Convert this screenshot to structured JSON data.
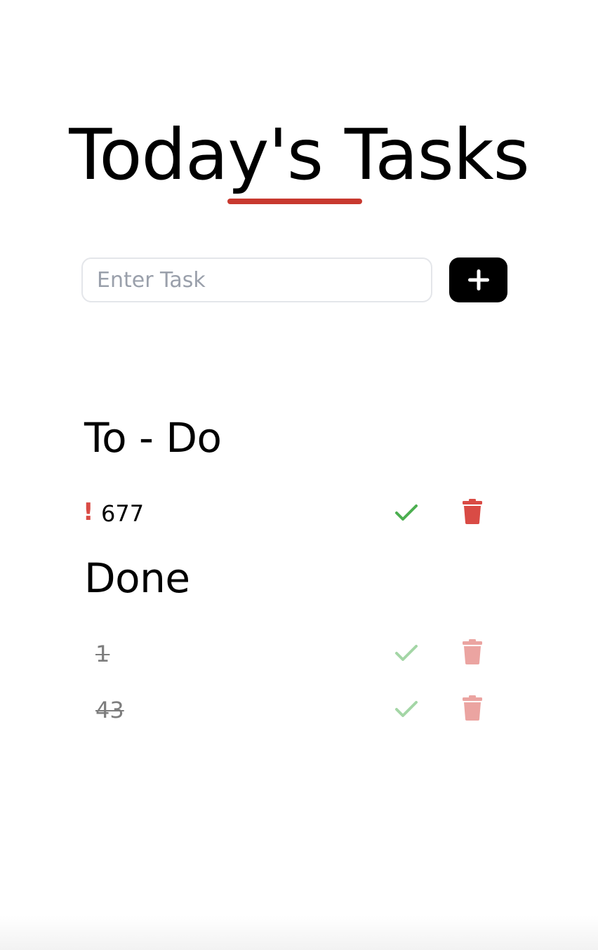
{
  "header": {
    "title": "Today's Tasks",
    "accent_color": "#c8392f"
  },
  "new_task": {
    "placeholder": "Enter Task",
    "value": "",
    "add_icon": "plus-icon"
  },
  "sections": {
    "todo": {
      "heading": "To - Do",
      "tasks": [
        {
          "text": "677",
          "priority_mark": "!",
          "priority_icon": "exclamation-icon"
        }
      ]
    },
    "done": {
      "heading": "Done",
      "tasks": [
        {
          "text": "1"
        },
        {
          "text": "43"
        }
      ]
    }
  },
  "icons": {
    "complete": "checkmark-icon",
    "delete": "trash-icon"
  },
  "colors": {
    "check": "#4caf50",
    "delete": "#d94b45",
    "priority": "#d94b45",
    "done_text": "#7d7d7d"
  }
}
